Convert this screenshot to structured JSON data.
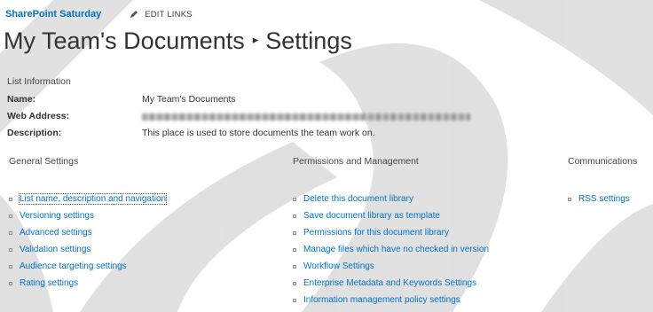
{
  "header": {
    "site_title": "SharePoint Saturday",
    "edit_links": "EDIT LINKS",
    "page_title": "My Team's Documents",
    "separator": "▸",
    "page_subtitle": "Settings"
  },
  "list_information": {
    "section_title": "List Information",
    "name_label": "Name:",
    "name_value": "My Team's Documents",
    "web_address_label": "Web Address:",
    "description_label": "Description:",
    "description_value": "This place is used to store documents the team work on."
  },
  "columns": {
    "general": {
      "title": "General Settings",
      "links": [
        "List name, description and navigation",
        "Versioning settings",
        "Advanced settings",
        "Validation settings",
        "Audience targeting settings",
        "Rating settings"
      ]
    },
    "permissions": {
      "title": "Permissions and Management",
      "links": [
        "Delete this document library",
        "Save document library as template",
        "Permissions for this document library",
        "Manage files which have no checked in version",
        "Workflow Settings",
        "Enterprise Metadata and Keywords Settings",
        "Information management policy settings"
      ]
    },
    "communications": {
      "title": "Communications",
      "links": [
        "RSS settings"
      ]
    }
  },
  "colors": {
    "link": "#0072c6",
    "text": "#444444",
    "watermark": "#c8c8c8"
  }
}
